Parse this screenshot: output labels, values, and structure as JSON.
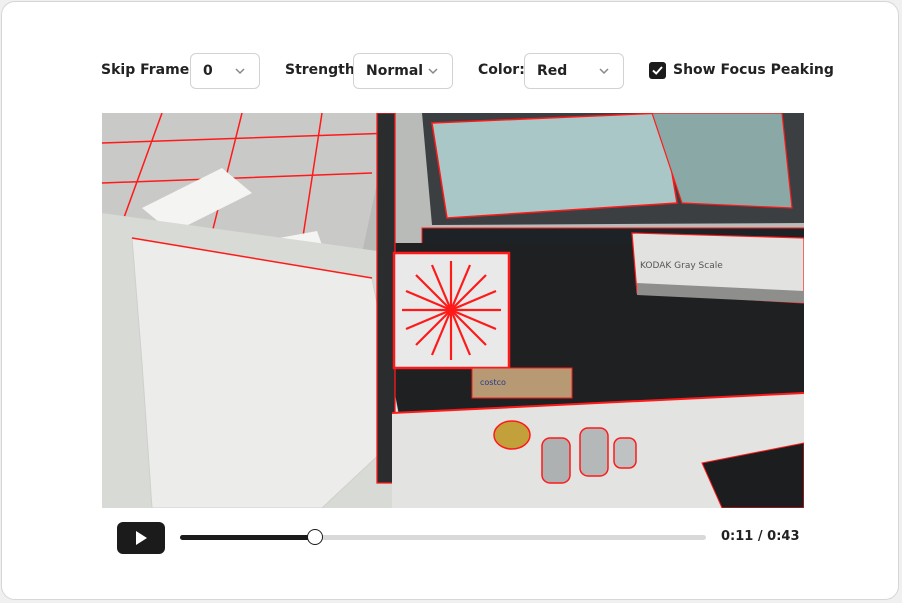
{
  "controls": {
    "skip_frames": {
      "label": "Skip Frames:",
      "value": "0"
    },
    "strength": {
      "label": "Strength:",
      "value": "Normal"
    },
    "color": {
      "label": "Color:",
      "value": "Red"
    },
    "show_focus_peaking": {
      "label": "Show Focus Peaking",
      "checked": true
    }
  },
  "video": {
    "frame_texts": {
      "card_brand": "KODAK Gray Scale",
      "box_label": "costco"
    },
    "accent_color": "#ff1a1a"
  },
  "player": {
    "current_time": "0:11",
    "separator": "/",
    "duration": "0:43",
    "progress": 0.2558
  }
}
